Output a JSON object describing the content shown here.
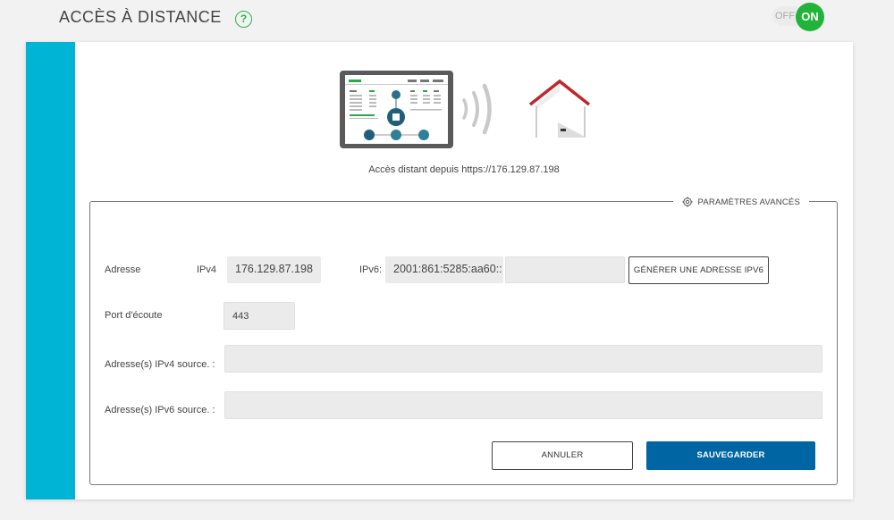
{
  "header": {
    "title": "ACCÈS À DISTANCE",
    "help_icon": "?",
    "toggle": {
      "off_label": "OFF",
      "on_label": "ON",
      "state": "on"
    }
  },
  "card": {
    "illustration": {
      "device": "tablet-icon",
      "signal": "wifi-signal-icon",
      "home": "house-icon"
    },
    "remote_url_text": "Accès distant depuis https://176.129.87.198",
    "advanced": {
      "title": "PARAMÈTRES AVANCÉS",
      "address_label": "Adresse",
      "ipv4_label": "IPv4",
      "ipv4_value": "176.129.87.198",
      "ipv6_label": "IPv6:",
      "ipv6_prefix_value": "2001:861:5285:aa60::",
      "ipv6_suffix_value": "",
      "generate_ipv6_label": "GÉNÉRER UNE ADRESSE IPV6",
      "port_label": "Port d'écoute",
      "port_value": "443",
      "ipv4_source_label": "Adresse(s) IPv4 source. :",
      "ipv4_source_value": "",
      "ipv6_source_label": "Adresse(s) IPv6 source. :",
      "ipv6_source_value": "",
      "cancel_label": "ANNULER",
      "save_label": "SAUVEGARDER"
    }
  },
  "colors": {
    "accent": "#00b4d6",
    "toggle_on": "#21b33a",
    "primary_button": "#0065a3",
    "house_roof": "#c0262d"
  }
}
